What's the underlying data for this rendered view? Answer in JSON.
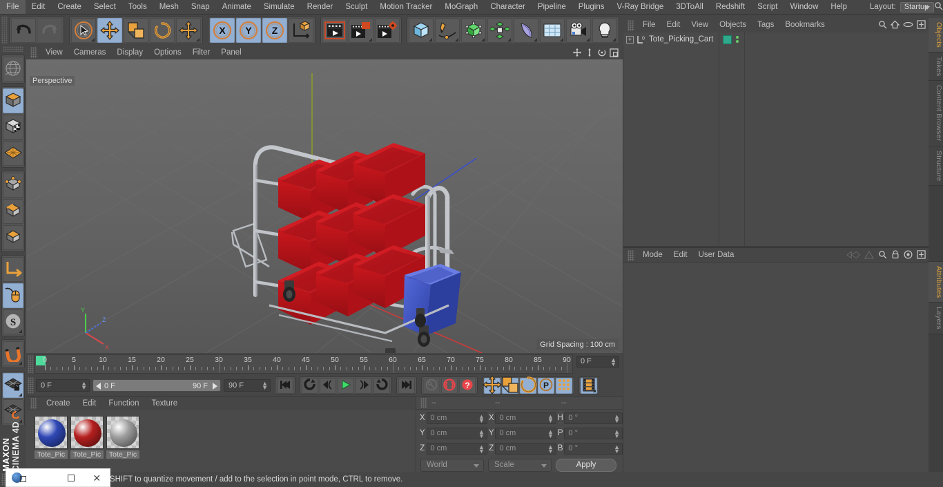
{
  "menubar": {
    "items": [
      "File",
      "Edit",
      "Create",
      "Select",
      "Tools",
      "Mesh",
      "Snap",
      "Animate",
      "Simulate",
      "Render",
      "Sculpt",
      "Motion Tracker",
      "MoGraph",
      "Character",
      "Pipeline",
      "Plugins",
      "V-Ray Bridge",
      "3DToAll",
      "Redshift",
      "Script",
      "Window",
      "Help"
    ],
    "layout_label": "Layout:",
    "layout_value": "Startup",
    "search_icon": "search-icon"
  },
  "toolbar": {
    "groups": [
      {
        "name": "history",
        "buttons": [
          {
            "name": "undo-button",
            "icon": "undo-icon",
            "selected": false,
            "dim": false
          },
          {
            "name": "redo-button",
            "icon": "redo-icon",
            "selected": false,
            "dim": true
          }
        ]
      },
      {
        "name": "transform-tools",
        "buttons": [
          {
            "name": "live-selection-tool",
            "icon": "cursor-circle-icon",
            "selected": false,
            "dim": false,
            "corner": true
          },
          {
            "name": "move-tool",
            "icon": "move-arrows-icon",
            "selected": true,
            "dim": false
          },
          {
            "name": "scale-tool",
            "icon": "scale-box-icon",
            "selected": false,
            "dim": false
          },
          {
            "name": "rotate-tool",
            "icon": "rotate-arc-icon",
            "selected": false,
            "dim": false
          },
          {
            "name": "free-transform-tool",
            "icon": "move-arrows-icon",
            "selected": false,
            "dim": false,
            "corner": true
          }
        ]
      },
      {
        "name": "axis-locks",
        "buttons": [
          {
            "name": "lock-x-axis-button",
            "icon": "x-axis-icon",
            "selected": true,
            "dim": false
          },
          {
            "name": "lock-y-axis-button",
            "icon": "y-axis-icon",
            "selected": true,
            "dim": false
          },
          {
            "name": "lock-z-axis-button",
            "icon": "z-axis-icon",
            "selected": true,
            "dim": false
          },
          {
            "name": "world-object-axis-button",
            "icon": "axis-cube-icon",
            "selected": false,
            "dim": false
          }
        ]
      },
      {
        "name": "render-tools",
        "buttons": [
          {
            "name": "render-view-button",
            "icon": "render-view-icon",
            "selected": false,
            "dim": false
          },
          {
            "name": "render-region-button",
            "icon": "render-region-icon",
            "selected": false,
            "dim": false,
            "corner": true
          },
          {
            "name": "render-settings-button",
            "icon": "render-settings-icon",
            "selected": false,
            "dim": false
          }
        ]
      },
      {
        "name": "create-objects",
        "buttons": [
          {
            "name": "add-cube-button",
            "icon": "cube-icon",
            "selected": false,
            "dim": false,
            "corner": true
          },
          {
            "name": "add-spline-button",
            "icon": "pen-spline-icon",
            "selected": false,
            "dim": false,
            "corner": true
          },
          {
            "name": "add-generator-button",
            "icon": "green-cube-icon",
            "selected": false,
            "dim": false,
            "corner": true
          },
          {
            "name": "add-mograph-button",
            "icon": "cloner-icon",
            "selected": false,
            "dim": false,
            "corner": true
          },
          {
            "name": "add-deformer-button",
            "icon": "bend-deformer-icon",
            "selected": false,
            "dim": false,
            "corner": true
          },
          {
            "name": "add-environment-button",
            "icon": "floor-grid-icon",
            "selected": false,
            "dim": false,
            "corner": true
          },
          {
            "name": "add-camera-button",
            "icon": "camera-icon",
            "selected": false,
            "dim": false,
            "corner": true
          },
          {
            "name": "add-light-button",
            "icon": "light-bulb-icon",
            "selected": false,
            "dim": false,
            "corner": true
          }
        ]
      }
    ]
  },
  "left_toolbar": {
    "groups": [
      {
        "name": "undo-view-group",
        "buttons": [
          {
            "name": "undo-view-button",
            "icon": "globe-wire-icon",
            "selected": false
          }
        ]
      },
      {
        "name": "mode-group-1",
        "buttons": [
          {
            "name": "make-editable-button",
            "icon": "orange-cube-icon",
            "selected": true
          },
          {
            "name": "model-mode-button",
            "icon": "checker-cube-icon",
            "selected": false
          },
          {
            "name": "texture-mode-button",
            "icon": "texture-grid-icon",
            "selected": false
          }
        ]
      },
      {
        "name": "component-modes",
        "buttons": [
          {
            "name": "points-mode-button",
            "icon": "point-cube-icon",
            "selected": false
          },
          {
            "name": "edges-mode-button",
            "icon": "edge-cube-icon",
            "selected": false
          },
          {
            "name": "polygons-mode-button",
            "icon": "polygon-cube-icon",
            "selected": false
          }
        ]
      },
      {
        "name": "axis-tools",
        "buttons": [
          {
            "name": "enable-axis-button",
            "icon": "axis-l-icon",
            "selected": false
          },
          {
            "name": "viewport-solo-button",
            "icon": "mouse-icon",
            "selected": true
          },
          {
            "name": "workplane-button",
            "icon": "s-circle-icon",
            "selected": false,
            "corner": true
          }
        ]
      },
      {
        "name": "snap-group",
        "buttons": [
          {
            "name": "enable-snapping-button",
            "icon": "magnet-icon",
            "selected": false,
            "corner": true
          }
        ]
      },
      {
        "name": "workplane-group",
        "buttons": [
          {
            "name": "lock-workplane-button",
            "icon": "workplane-lock-icon",
            "selected": true,
            "corner": true
          },
          {
            "name": "planar-workplane-button",
            "icon": "workplane-rotate-icon",
            "selected": false,
            "corner": true
          }
        ]
      }
    ],
    "brand_top": "MAXON",
    "brand_bottom": "CINEMA 4D"
  },
  "viewport": {
    "menu_items": [
      "View",
      "Cameras",
      "Display",
      "Options",
      "Filter",
      "Panel"
    ],
    "icons": [
      "pan-icon",
      "zoom-icon",
      "rotate-view-icon",
      "maximize-view-icon"
    ],
    "label": "Perspective",
    "grid_spacing": "Grid Spacing : 100 cm",
    "axis_gizmo": {
      "x": "X",
      "y": "Y",
      "z": "Z",
      "x_color": "#d94a4a",
      "y_color": "#4ad14a",
      "z_color": "#4a6fd9"
    },
    "scene": {
      "name": "Tote_Picking_Cart",
      "cart_frame_color": "#c5c8cc",
      "tote_color": "#c0181c",
      "bin_color": "#3f54bd",
      "wheel_color": "#2b2b2b",
      "tote_rows": 3,
      "tote_columns": 3
    }
  },
  "timeline": {
    "ticks": [
      0,
      5,
      10,
      15,
      20,
      25,
      30,
      35,
      40,
      45,
      50,
      55,
      60,
      65,
      70,
      75,
      80,
      85,
      90
    ],
    "current_frame_field": "0 F",
    "playhead_frame": 0
  },
  "playbar": {
    "current_frame": "0 F",
    "range_start": "0 F",
    "range_end": "90 F",
    "end_frame": "90 F",
    "buttons": [
      {
        "name": "go-to-start-button",
        "icon": "skip-start-icon",
        "selected": false,
        "dim": false
      },
      {
        "name": "play-backwards-button",
        "icon": "rewind-loop-icon",
        "selected": false,
        "dim": false
      },
      {
        "name": "previous-frame-button",
        "icon": "step-back-icon",
        "selected": false,
        "dim": false
      },
      {
        "name": "play-button",
        "icon": "play-icon",
        "selected": false,
        "dim": false
      },
      {
        "name": "next-frame-button",
        "icon": "step-forward-icon",
        "selected": false,
        "dim": false
      },
      {
        "name": "play-forwards-button",
        "icon": "forward-loop-icon",
        "selected": false,
        "dim": false
      },
      {
        "name": "go-to-end-button",
        "icon": "skip-end-icon",
        "selected": false,
        "dim": false
      },
      {
        "name": "record-active-objects-button",
        "icon": "key-icon",
        "selected": false,
        "dim": true
      },
      {
        "name": "autokeying-button",
        "icon": "auto-key-icon",
        "selected": false,
        "dim": false
      },
      {
        "name": "keyframe-selection-button",
        "icon": "question-key-icon",
        "selected": false,
        "dim": false
      },
      {
        "name": "position-key-button",
        "icon": "move-arrows-icon",
        "selected": true,
        "dim": false
      },
      {
        "name": "scale-key-button",
        "icon": "scale-box-icon",
        "selected": true,
        "dim": false
      },
      {
        "name": "rotation-key-button",
        "icon": "rotate-arc-icon",
        "selected": true,
        "dim": false
      },
      {
        "name": "parameter-key-button",
        "icon": "p-circle-icon",
        "selected": true,
        "dim": false
      },
      {
        "name": "point-level-animation-button",
        "icon": "dots-grid-icon",
        "selected": true,
        "dim": false
      },
      {
        "name": "timeline-mode-button",
        "icon": "film-strip-icon",
        "selected": true,
        "dim": false,
        "corner": true
      }
    ]
  },
  "material_manager": {
    "menu_items": [
      "Create",
      "Edit",
      "Function",
      "Texture"
    ],
    "materials": [
      {
        "name": "Tote_Pic",
        "color": "#2f47b5"
      },
      {
        "name": "Tote_Pic",
        "color": "#b51f1f"
      },
      {
        "name": "Tote_Pic",
        "color": "#9e9e9e"
      }
    ]
  },
  "coordinates": {
    "headers": [
      "--",
      "--",
      "--"
    ],
    "rows": [
      {
        "pos_label": "X",
        "pos_value": "0 cm",
        "size_label": "X",
        "size_value": "0 cm",
        "rot_label": "H",
        "rot_value": "0 °"
      },
      {
        "pos_label": "Y",
        "pos_value": "0 cm",
        "size_label": "Y",
        "size_value": "0 cm",
        "rot_label": "P",
        "rot_value": "0 °"
      },
      {
        "pos_label": "Z",
        "pos_value": "0 cm",
        "size_label": "Z",
        "size_value": "0 cm",
        "rot_label": "B",
        "rot_value": "0 °"
      }
    ],
    "system_select": "World",
    "mode_select": "Scale",
    "apply_label": "Apply"
  },
  "object_manager": {
    "menu_items": [
      "File",
      "Edit",
      "View",
      "Objects",
      "Tags",
      "Bookmarks"
    ],
    "icons": [
      "search-icon",
      "home-icon",
      "ellipse-icon",
      "plus-box-icon"
    ],
    "objects": [
      {
        "name": "Tote_Picking_Cart",
        "expandable": true,
        "layer_mark": "0",
        "tag_color": "#2fa98b",
        "visibility_dots": 2
      }
    ]
  },
  "attribute_manager": {
    "menu_items": [
      "Mode",
      "Edit",
      "User Data"
    ],
    "icons": [
      "back-nav-icon",
      "up-nav-icon",
      "search-icon",
      "lock-icon",
      "target-icon",
      "plus-box-icon"
    ]
  },
  "right_tabs": [
    {
      "label": "Objects",
      "active": true
    },
    {
      "label": "Takes",
      "active": false
    },
    {
      "label": "Content Browser",
      "active": false
    },
    {
      "label": "Structure",
      "active": false
    },
    {
      "label": "Attributes",
      "active": true
    },
    {
      "label": "Layers",
      "active": false
    }
  ],
  "statusbar": {
    "text": "Move elements. Hold down SHIFT to quantize movement / add to the selection in point mode, CTRL to remove."
  },
  "os_overlay": {
    "buttons": [
      "browser-icon",
      "minimize-icon",
      "restore-icon",
      "close-icon"
    ]
  },
  "colors": {
    "panel_bg": "#4a4a4a",
    "chrome_bg": "#464646",
    "selected_blue": "#93afd2",
    "accent_orange": "#e0a33c",
    "viewport_bg": "#5e5e5e"
  }
}
